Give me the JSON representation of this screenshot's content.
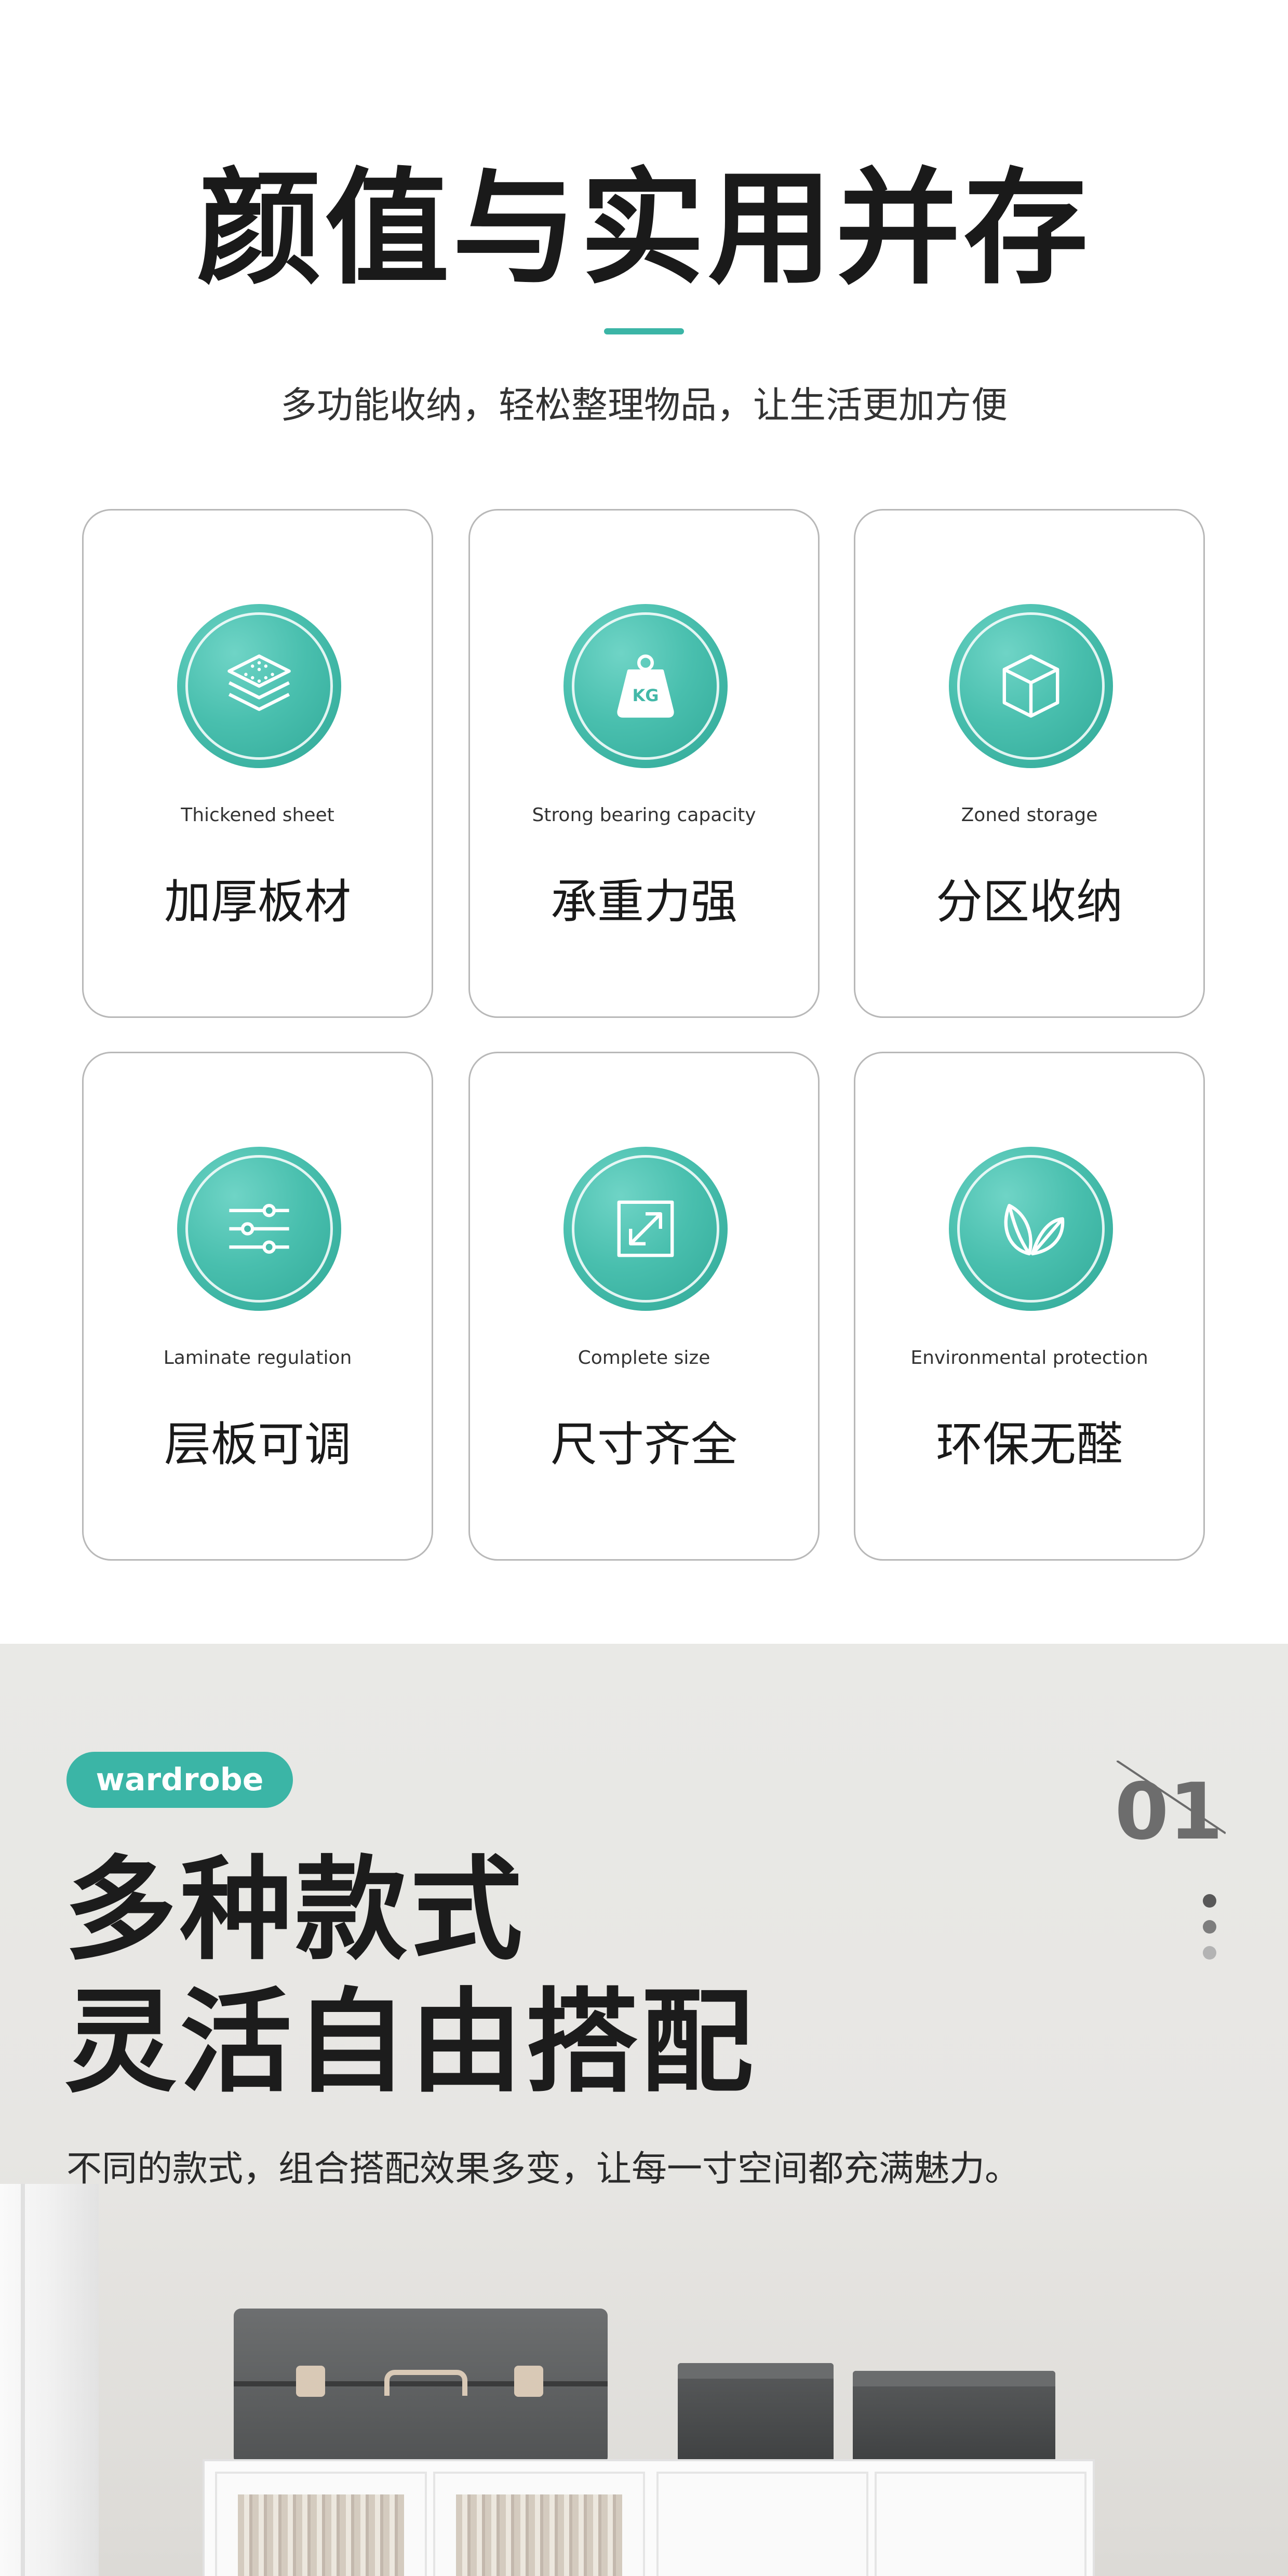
{
  "header": {
    "title": "颜值与实用并存",
    "subtitle": "多功能收纳，轻松整理物品，让生活更加方便"
  },
  "features": [
    {
      "icon": "layers-icon",
      "en": "Thickened sheet",
      "zh": "加厚板材"
    },
    {
      "icon": "kg-weight-icon",
      "en": "Strong bearing capacity",
      "zh": "承重力强"
    },
    {
      "icon": "cube-icon",
      "en": "Zoned storage",
      "zh": "分区收纳"
    },
    {
      "icon": "sliders-icon",
      "en": "Laminate regulation",
      "zh": "层板可调"
    },
    {
      "icon": "resize-icon",
      "en": "Complete size",
      "zh": "尺寸齐全"
    },
    {
      "icon": "leaves-icon",
      "en": "Environmental protection",
      "zh": "环保无醛"
    }
  ],
  "promo": {
    "tag": "wardrobe",
    "headline_line1": "多种款式",
    "headline_line2": "灵活自由搭配",
    "description": "不同的款式，组合搭配效果多变，让每一寸空间都充满魅力。",
    "page_number": "01",
    "kg_label": "KG"
  },
  "colors": {
    "accent": "#3bb5a6",
    "title_text": "#1a1a1a",
    "card_border": "#b8b8b8"
  }
}
